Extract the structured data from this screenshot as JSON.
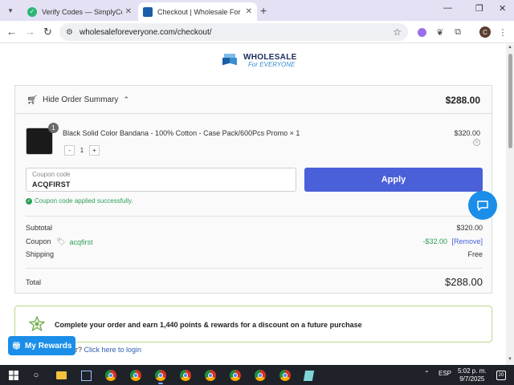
{
  "browser": {
    "tabs": [
      {
        "title": "Verify Codes — SimplyCodes",
        "active": false
      },
      {
        "title": "Checkout | Wholesale For Everyone",
        "active": true
      }
    ],
    "new_tab_symbol": "+",
    "url": "wholesaleforeveryone.com/checkout/",
    "profile_initial": "C",
    "window_controls": {
      "minimize": "—",
      "restore": "❐",
      "close": "✕"
    }
  },
  "site": {
    "logo_line1": "WHOLESALE",
    "logo_line2": "For EVERYONE"
  },
  "summary": {
    "toggle_label": "Hide Order Summary",
    "header_total": "$288.00",
    "item": {
      "quantity_badge": "1",
      "name": "Black Solid Color Bandana - 100% Cotton - Case Pack/600Pcs Promo",
      "qty_suffix": "× 1",
      "price": "$320.00",
      "stepper_minus": "-",
      "stepper_value": "1",
      "stepper_plus": "+"
    },
    "coupon": {
      "label": "Coupon code",
      "value": "ACQFIRST",
      "apply_label": "Apply",
      "success_message": "Coupon code applied successfully."
    },
    "subtotal_label": "Subtotal",
    "subtotal_value": "$320.00",
    "coupon_row_label": "Coupon",
    "coupon_row_code": "acqfirst",
    "coupon_row_discount": "-$32.00",
    "coupon_row_remove": "[Remove]",
    "shipping_label": "Shipping",
    "shipping_value": "Free",
    "total_label": "Total",
    "total_value": "$288.00"
  },
  "rewards": {
    "banner_message": "Complete your order and earn 1,440 points & rewards for a discount on a future purchase",
    "login_prefix": "r?",
    "login_link": "Click here to login",
    "button_label": "My Rewards"
  },
  "taskbar": {
    "language": "ESP",
    "time": "5:02 p. m.",
    "date": "9/7/2025",
    "notification_count": "20"
  },
  "colors": {
    "apply_button": "#4a60d9",
    "success_green": "#2e9e5a",
    "chat_blue": "#1a8ee8",
    "banner_border": "#b8d98a"
  }
}
